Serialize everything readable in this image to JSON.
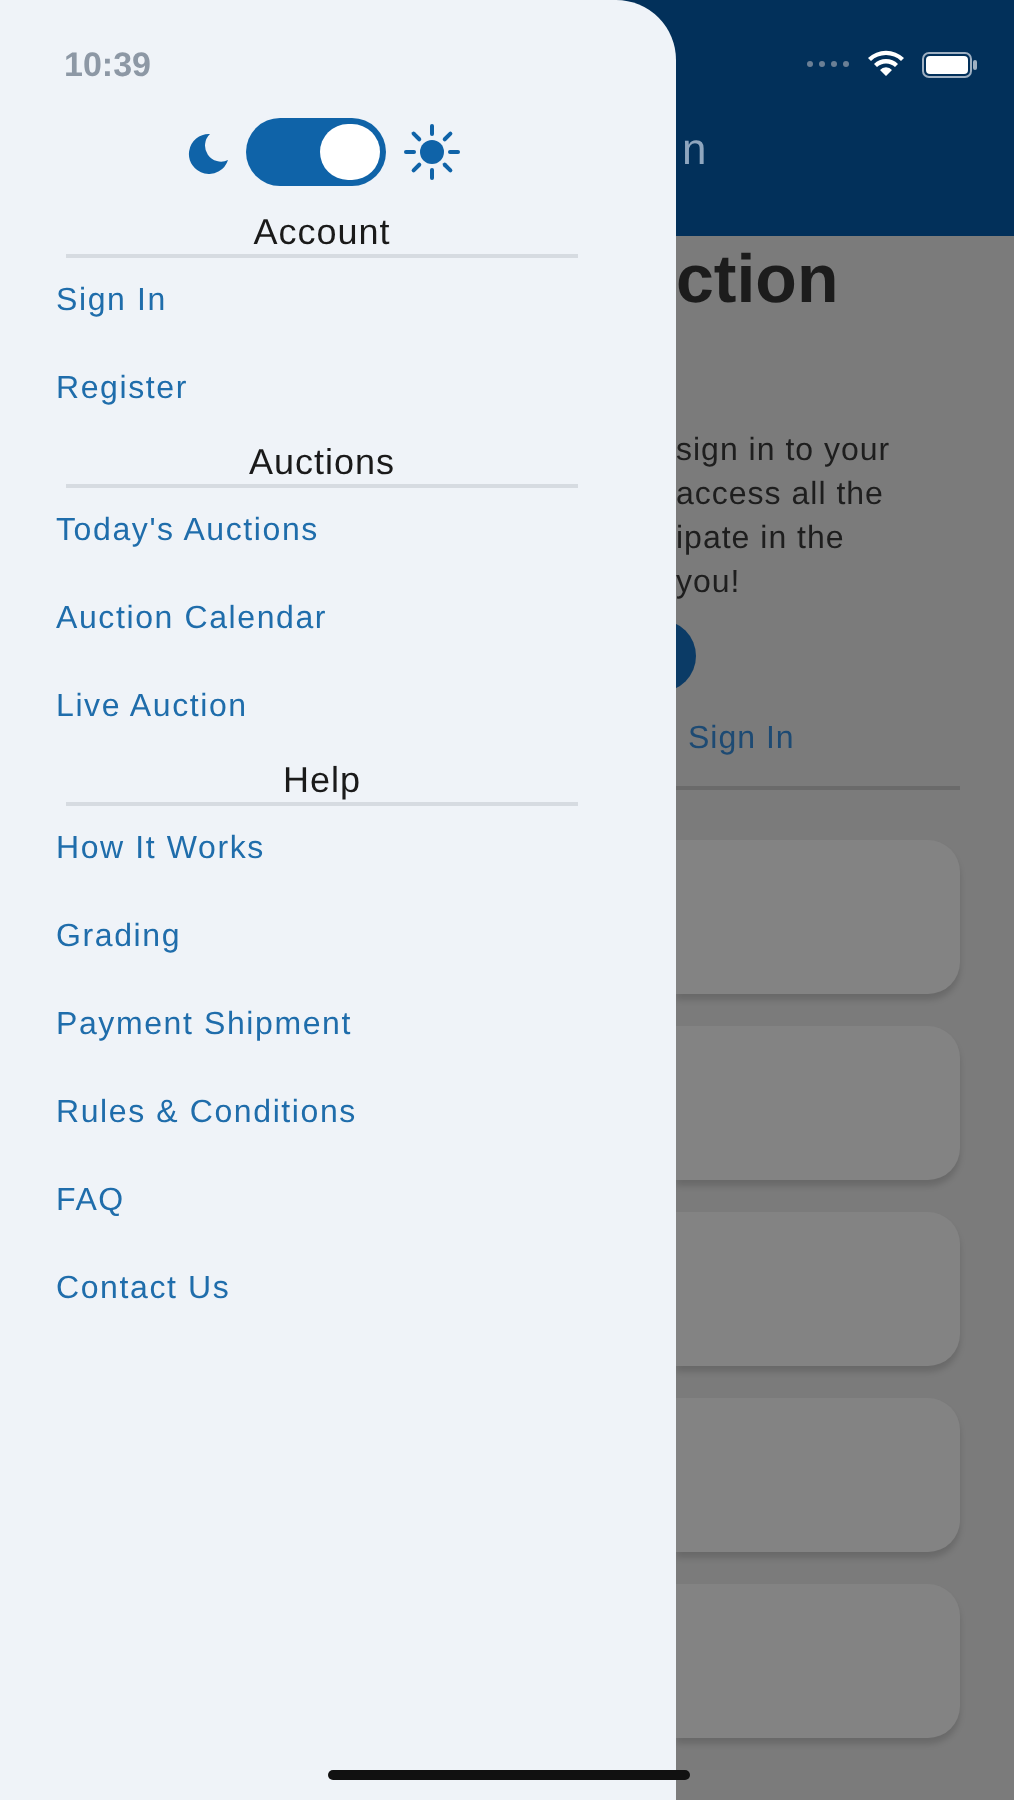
{
  "status_bar": {
    "time": "10:39"
  },
  "background_page": {
    "header_title": "n",
    "heading": "ction",
    "intro_lines": [
      "sign in to your",
      "access all the",
      "ipate in the",
      "you!"
    ],
    "sign_in_link": "Sign In",
    "cards": [
      {
        "kind": "card"
      },
      {
        "kind": "card"
      },
      {
        "kind": "card"
      },
      {
        "kind": "card"
      },
      {
        "kind": "card"
      }
    ]
  },
  "drawer": {
    "theme_toggle": {
      "on": true
    },
    "sections": [
      {
        "title": "Account",
        "items": [
          "Sign In",
          "Register"
        ]
      },
      {
        "title": "Auctions",
        "items": [
          "Today's Auctions",
          "Auction Calendar",
          "Live Auction"
        ]
      },
      {
        "title": "Help",
        "items": [
          "How It Works",
          "Grading",
          "Payment Shipment",
          "Rules & Conditions",
          "FAQ",
          "Contact Us"
        ]
      }
    ]
  }
}
